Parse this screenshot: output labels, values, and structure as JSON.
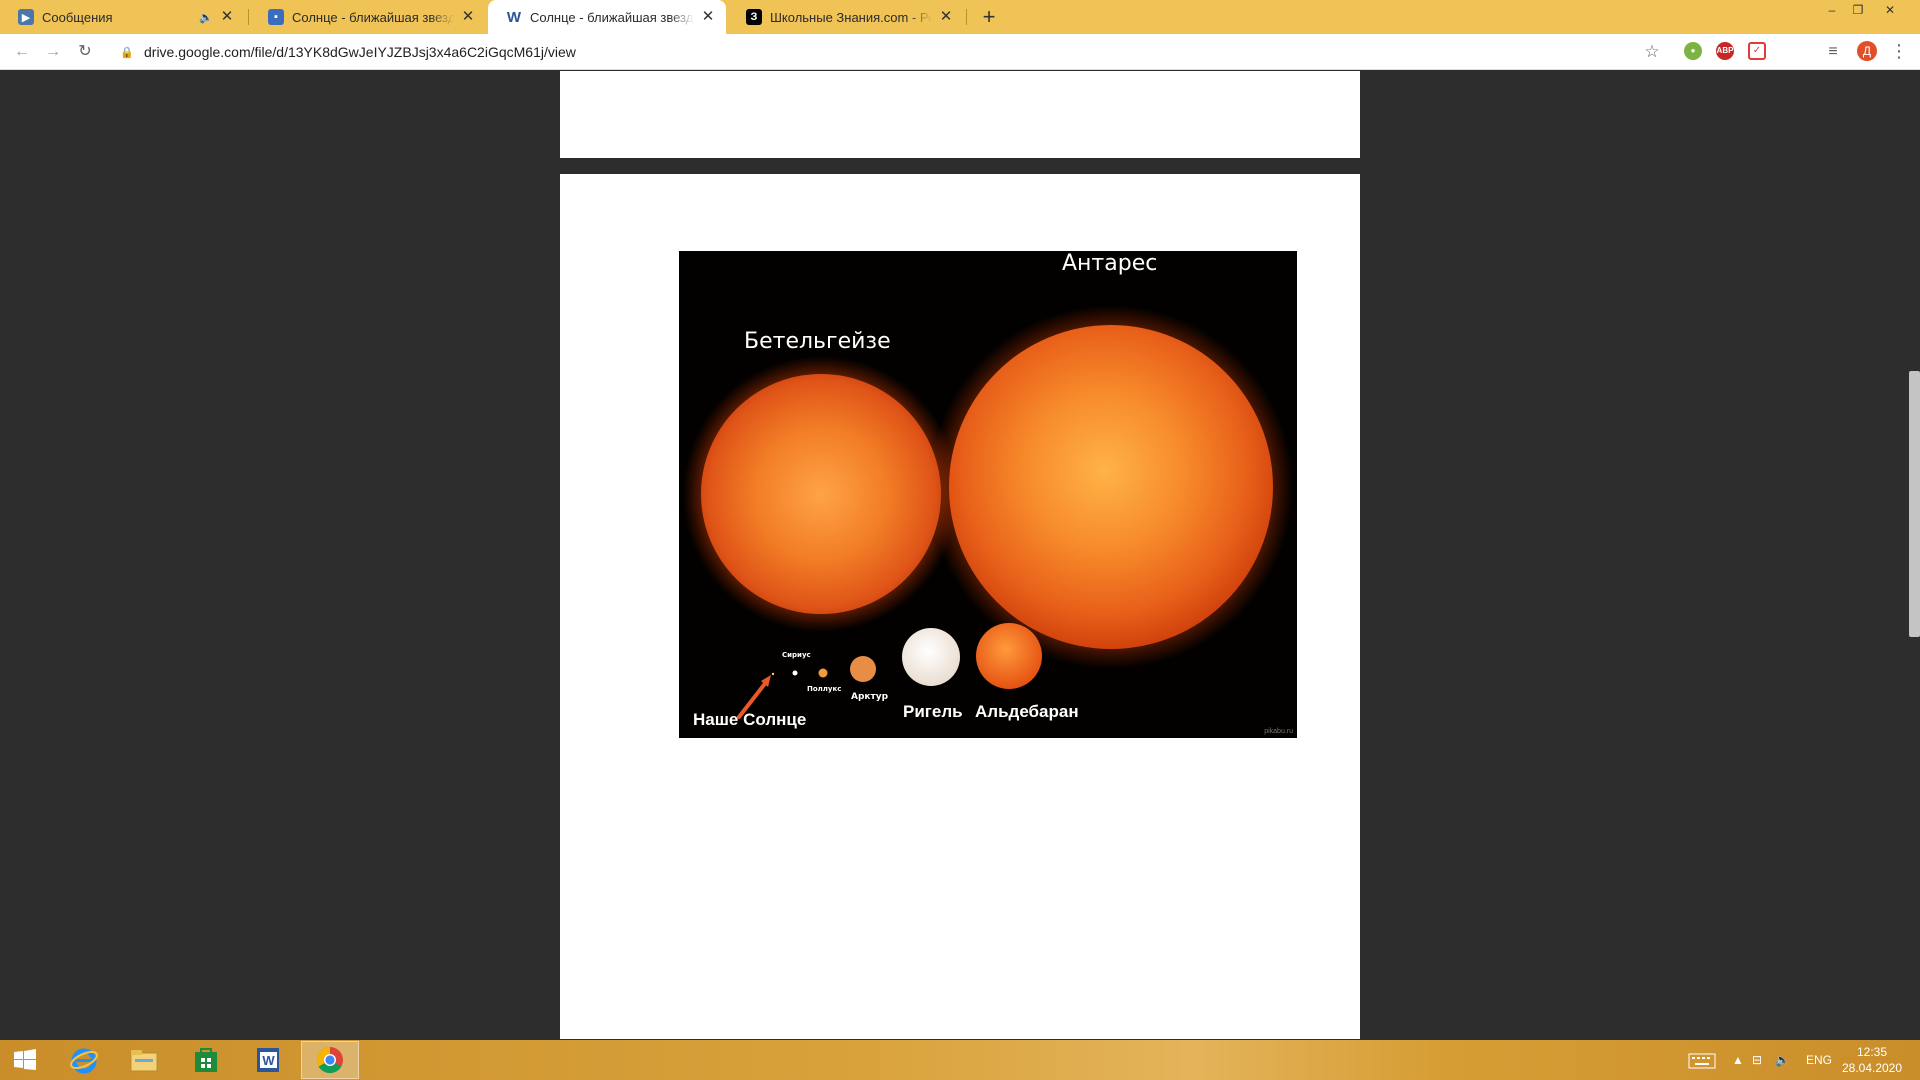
{
  "browser": {
    "tabs": [
      {
        "title": "Сообщения",
        "icon": "messages-icon",
        "color": "#4a76a8",
        "audio": true
      },
      {
        "title": "Солнце - ближайшая звезда. Мультиурок",
        "icon": "presentation-icon",
        "color": "#3b6dbf",
        "audio": false
      },
      {
        "title": "Солнце - ближайшая звезда Солнечной системы",
        "icon": "word-icon",
        "color": "#2b579a",
        "audio": false,
        "active": true
      },
      {
        "title": "Школьные Знания.com - Решаем вместе",
        "icon": "znanija-icon",
        "color": "#000000",
        "audio": false
      }
    ],
    "url": "drive.google.com/file/d/13YK8dGwJeIYJZBJsj3x4a6C2iGqcM61j/view",
    "profile_initial": "Д",
    "extensions": {
      "abp": "ABP"
    },
    "tab_glyphs": {
      "word": "W",
      "znanija": "З",
      "audio": "🔈",
      "close": "✕",
      "new_tab": "+"
    }
  },
  "document": {
    "labels": {
      "antares": "Антарес",
      "betelgeuse": "Бетельгейзе",
      "sirius": "Сириус",
      "pollux": "Поллукс",
      "arcturus": "Арктур",
      "rigel": "Ригель",
      "aldebaran": "Альдебаран",
      "sun": "Наше Солнце",
      "watermark": "pikabu.ru"
    }
  },
  "taskbar": {
    "language": "ENG",
    "time": "12:35",
    "date": "28.04.2020"
  },
  "colors": {
    "tabstrip": "#f0c356",
    "viewer_bg": "#2d2d2d",
    "star_orange": "#f07a1c",
    "star_dark": "#b8320a"
  }
}
